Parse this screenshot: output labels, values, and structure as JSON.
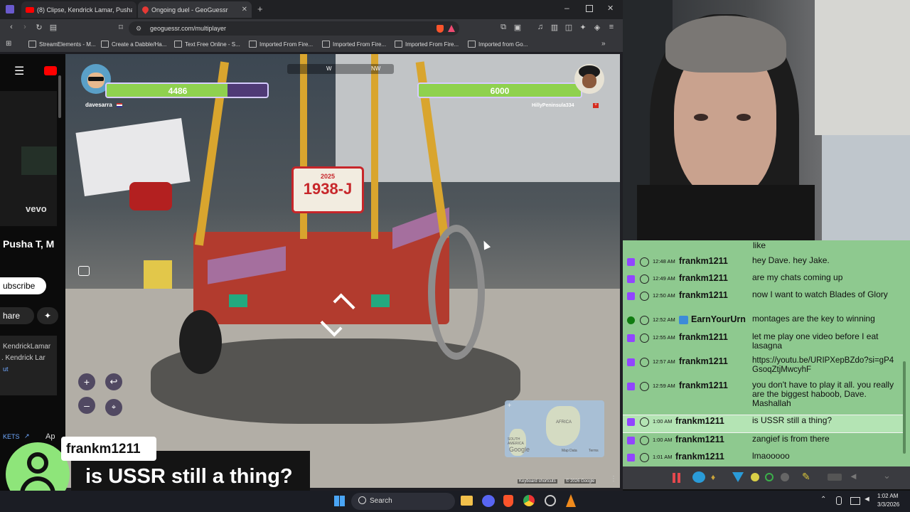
{
  "browser": {
    "tabs": [
      {
        "title": "(8) Clipse, Kendrick Lamar, Pusha"
      },
      {
        "title": "Ongoing duel - GeoGuessr"
      }
    ],
    "url": "geoguessr.com/multiplayer",
    "bookmarks": [
      "StreamElements - M...",
      "Create a Dabble/Ha...",
      "Text Free Online - S...",
      "Imported From Fire...",
      "Imported From Fire...",
      "Imported From Fire...",
      "Imported from Go..."
    ]
  },
  "youtube_sidebar": {
    "vevo": "vevo",
    "title": "Pusha T, M",
    "subscribe": "ubscribe",
    "share": "hare",
    "channel": "KendrickLamar",
    "subtitle": ". Kendrick Lar",
    "extra": "ut",
    "tickets": "KETS",
    "ap": "Ap"
  },
  "game": {
    "compass": [
      "W",
      "NW"
    ],
    "player_left": {
      "name": "davesarra",
      "health": "4486",
      "health_fraction": 0.75
    },
    "player_right": {
      "name": "HillyPeninsula334",
      "health": "6000",
      "health_fraction": 1.0
    },
    "plate": {
      "year": "2025",
      "number": "1938-J"
    },
    "map": {
      "labels": [
        "AFRICA",
        "SOUTH AMERICA"
      ],
      "google": "Google",
      "map_data": "Map Data",
      "terms": "Terms"
    },
    "footer": {
      "shortcuts": "Keyboard shortcuts",
      "copyright": "© 2026 Google"
    }
  },
  "chat": {
    "first_line": "like",
    "messages": [
      {
        "time": "12:48 AM",
        "user": "frankm1211",
        "text": "hey Dave. hey Jake."
      },
      {
        "time": "12:49 AM",
        "user": "frankm1211",
        "text": "are my chats coming up"
      },
      {
        "time": "12:50 AM",
        "user": "frankm1211",
        "text": "now I want to watch Blades of Glory"
      },
      {
        "time": "12:52 AM",
        "user": "EarnYourUrn",
        "text": "montages are the key to winning"
      },
      {
        "time": "12:55 AM",
        "user": "frankm1211",
        "text": "let me play one video before I eat lasagna"
      },
      {
        "time": "12:57 AM",
        "user": "frankm1211",
        "text": "https://youtu.be/URIPXepBZdo?si=gP4GsoqZtjMwcyhF"
      },
      {
        "time": "12:59 AM",
        "user": "frankm1211",
        "text": "you don't have to play it all. you really are the biggest haboob, Dave. Mashallah"
      },
      {
        "time": "1:00 AM",
        "user": "frankm1211",
        "text": "is USSR still a thing?"
      },
      {
        "time": "1:00 AM",
        "user": "frankm1211",
        "text": "zangief is from there"
      },
      {
        "time": "1:01 AM",
        "user": "frankm1211",
        "text": "lmaooooo"
      }
    ]
  },
  "alert": {
    "user": "frankm1211",
    "message": "is USSR still a thing?"
  },
  "taskbar": {
    "search": "Search",
    "time": "1:02 AM",
    "date": "3/3/2026"
  }
}
